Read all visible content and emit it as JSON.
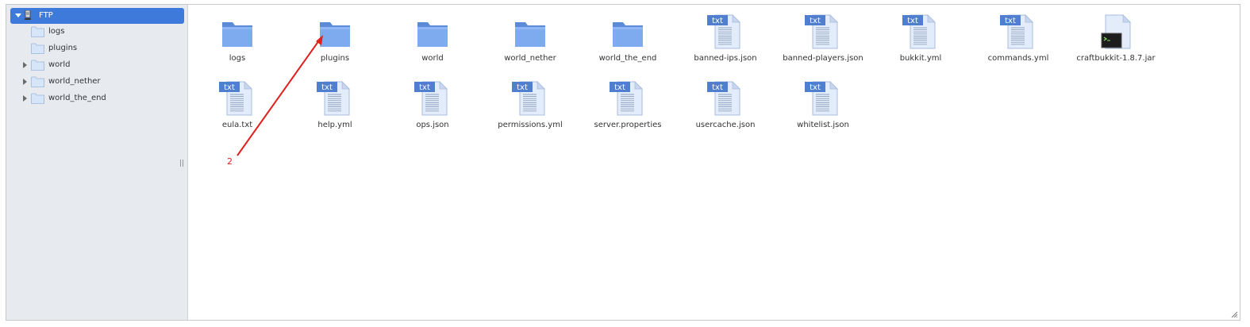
{
  "sidebar": {
    "root": {
      "label": "FTP",
      "icon": "server-icon"
    },
    "items": [
      {
        "label": "logs",
        "expandable": false
      },
      {
        "label": "plugins",
        "expandable": false
      },
      {
        "label": "world",
        "expandable": true
      },
      {
        "label": "world_nether",
        "expandable": true
      },
      {
        "label": "world_the_end",
        "expandable": true
      }
    ]
  },
  "files": [
    {
      "name": "logs",
      "type": "folder"
    },
    {
      "name": "plugins",
      "type": "folder"
    },
    {
      "name": "world",
      "type": "folder"
    },
    {
      "name": "world_nether",
      "type": "folder"
    },
    {
      "name": "world_the_end",
      "type": "folder"
    },
    {
      "name": "banned-ips.json",
      "type": "txt"
    },
    {
      "name": "banned-players.json",
      "type": "txt"
    },
    {
      "name": "bukkit.yml",
      "type": "txt"
    },
    {
      "name": "commands.yml",
      "type": "txt"
    },
    {
      "name": "craftbukkit-1.8.7.jar",
      "type": "jar"
    },
    {
      "name": "eula.txt",
      "type": "txt"
    },
    {
      "name": "help.yml",
      "type": "txt"
    },
    {
      "name": "ops.json",
      "type": "txt"
    },
    {
      "name": "permissions.yml",
      "type": "txt"
    },
    {
      "name": "server.properties",
      "type": "txt"
    },
    {
      "name": "usercache.json",
      "type": "txt"
    },
    {
      "name": "whitelist.json",
      "type": "txt"
    }
  ],
  "icon_badge": "txt",
  "annotation": {
    "label": "2",
    "color": "#e0201c"
  },
  "colors": {
    "selection": "#3d7ad9",
    "folder": "#6f9fe8",
    "sidebar_bg": "#e7ebf0"
  }
}
